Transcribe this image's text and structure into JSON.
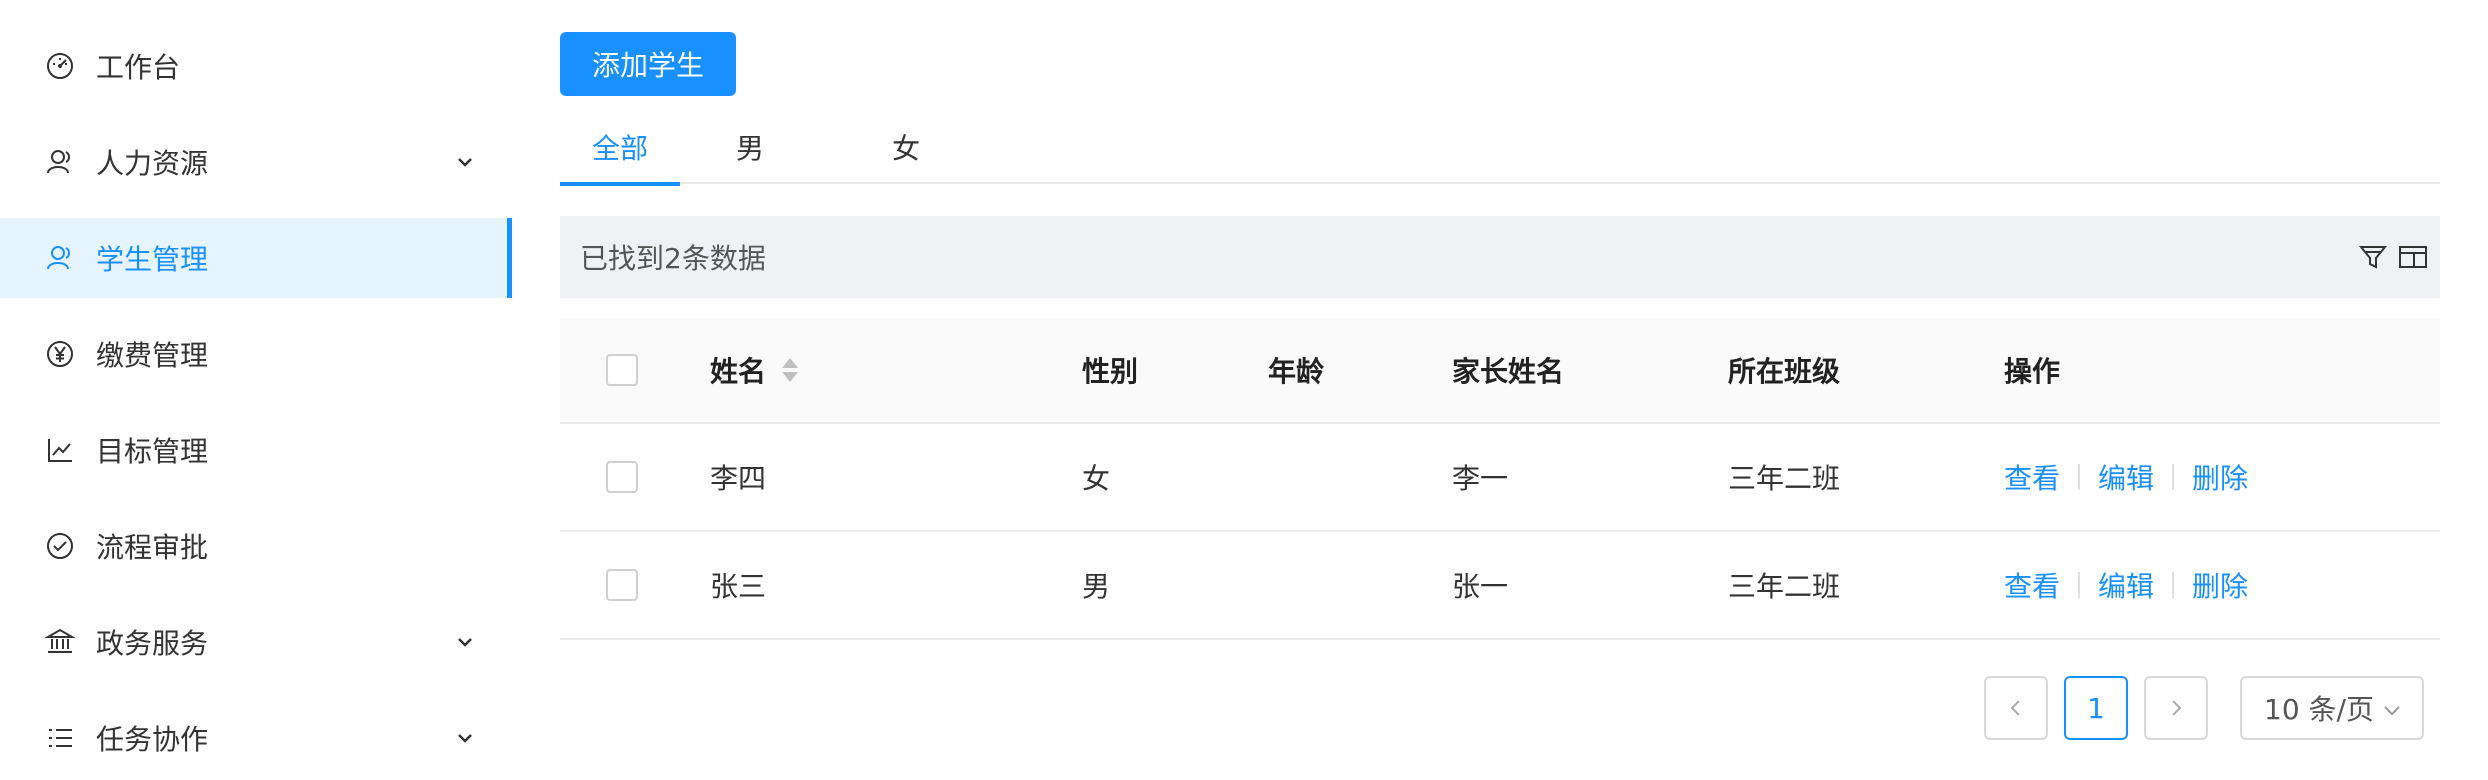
{
  "sidebar": {
    "items": [
      {
        "label": "工作台",
        "icon": "dashboard-icon"
      },
      {
        "label": "人力资源",
        "icon": "user-icon",
        "has_submenu": true
      },
      {
        "label": "学生管理",
        "icon": "user-icon",
        "active": true
      },
      {
        "label": "缴费管理",
        "icon": "yen-icon"
      },
      {
        "label": "目标管理",
        "icon": "line-chart-icon"
      },
      {
        "label": "流程审批",
        "icon": "check-circle-icon"
      },
      {
        "label": "政务服务",
        "icon": "bank-icon",
        "has_submenu": true
      },
      {
        "label": "任务协作",
        "icon": "list-icon",
        "has_submenu": true
      }
    ]
  },
  "toolbar": {
    "add_label": "添加学生"
  },
  "tabs": [
    {
      "label": "全部",
      "active": true
    },
    {
      "label": "男"
    },
    {
      "label": "女"
    }
  ],
  "summary": {
    "text": "已找到2条数据",
    "icons": [
      "filter-icon",
      "column-settings-icon"
    ]
  },
  "table": {
    "columns": [
      "姓名",
      "性别",
      "年龄",
      "家长姓名",
      "所在班级",
      "操作"
    ],
    "rows": [
      {
        "name": "李四",
        "gender": "女",
        "age": "",
        "parent": "李一",
        "class": "三年二班"
      },
      {
        "name": "张三",
        "gender": "男",
        "age": "",
        "parent": "张一",
        "class": "三年二班"
      }
    ],
    "actions": {
      "view": "查看",
      "edit": "编辑",
      "delete": "删除"
    }
  },
  "pagination": {
    "current_page": "1",
    "page_size": "10 条/页"
  },
  "colors": {
    "primary": "#1890ff",
    "active_bg": "#e6f4ff"
  }
}
